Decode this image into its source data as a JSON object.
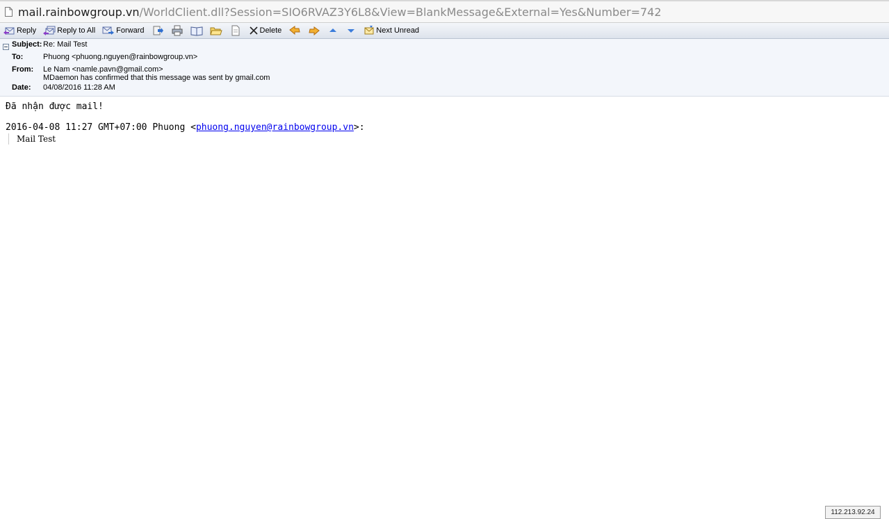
{
  "address_bar": {
    "host": "mail.rainbowgroup.vn",
    "path": "/WorldClient.dll?Session=SIO6RVAZ3Y6L8&View=BlankMessage&External=Yes&Number=742"
  },
  "toolbar": {
    "reply": "Reply",
    "reply_all": "Reply to All",
    "forward": "Forward",
    "delete": "Delete",
    "next_unread": "Next Unread",
    "icons": [
      "reply-icon",
      "reply-all-icon",
      "forward-icon",
      "move-icon",
      "print-icon",
      "address-book-icon",
      "open-folder-icon",
      "view-source-icon",
      "delete-icon",
      "previous-message-icon",
      "next-message-icon",
      "up-arrow-icon",
      "down-arrow-icon",
      "next-unread-icon"
    ]
  },
  "header": {
    "subject_label": "Subject:",
    "subject": "Re: Mail Test",
    "to_label": "To:",
    "to": "Phuong <phuong.nguyen@rainbowgroup.vn>",
    "from_label": "From:",
    "from": "Le Nam <namle.pavn@gmail.com>",
    "from_note": "MDaemon has confirmed that this message was sent by gmail.com",
    "date_label": "Date:",
    "date": "04/08/2016 11:28 AM"
  },
  "body": {
    "line1": "Đã nhận được mail!",
    "reply_intro": "2016-04-08 11:27 GMT+07:00 Phuong <",
    "reply_email": "phuong.nguyen@rainbowgroup.vn",
    "reply_outro": ">:",
    "quoted": "Mail Test"
  },
  "status": {
    "ip": "112.213.92.24"
  }
}
